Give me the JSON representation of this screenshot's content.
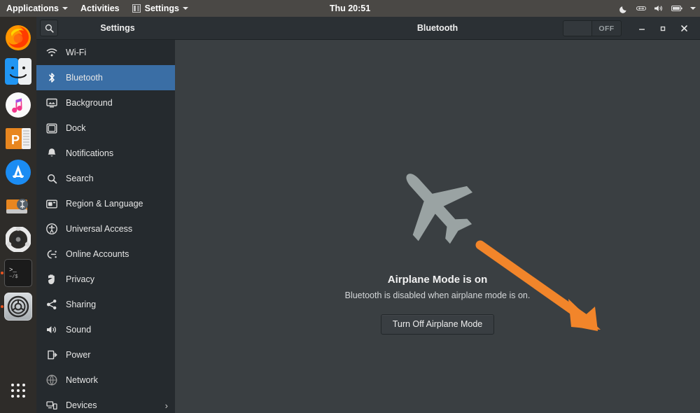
{
  "topbar": {
    "applications": {
      "label": "Applications",
      "icon": "chevron-down-icon"
    },
    "activities": {
      "label": "Activities"
    },
    "settings": {
      "label": "Settings",
      "icon": "settings-app-icon"
    },
    "clock": "Thu 20:51",
    "status_icons": [
      "night-light-moon-icon",
      "network-wired-icon",
      "volume-icon",
      "battery-icon",
      "chevron-down-icon"
    ]
  },
  "dock": {
    "items": [
      {
        "name": "firefox",
        "label": "Firefox"
      },
      {
        "name": "finder",
        "label": "Finder"
      },
      {
        "name": "music",
        "label": "Music"
      },
      {
        "name": "powerpoint",
        "label": "PowerPoint"
      },
      {
        "name": "app-store",
        "label": "App Store"
      },
      {
        "name": "disk-utility",
        "label": "Disk Utility"
      },
      {
        "name": "ubuntu-software",
        "label": "Ubuntu Software"
      },
      {
        "name": "terminal",
        "label": "Terminal"
      },
      {
        "name": "settings",
        "label": "Settings"
      }
    ],
    "show_apps_label": "Show Applications"
  },
  "window": {
    "sidebar_title": "Settings",
    "title": "Bluetooth",
    "search_placeholder": "Search settings",
    "toggle": {
      "state_label": "OFF",
      "checked": false
    },
    "controls": {
      "minimize": "‒",
      "maximize": "□",
      "close": "✕"
    }
  },
  "sidebar": {
    "items": [
      {
        "label": "Wi-Fi",
        "icon": "wifi-icon",
        "selected": false,
        "chevron": false
      },
      {
        "label": "Bluetooth",
        "icon": "bluetooth-icon",
        "selected": true,
        "chevron": false
      },
      {
        "label": "Background",
        "icon": "background-icon",
        "selected": false,
        "chevron": false
      },
      {
        "label": "Dock",
        "icon": "dock-icon",
        "selected": false,
        "chevron": false
      },
      {
        "label": "Notifications",
        "icon": "bell-icon",
        "selected": false,
        "chevron": false
      },
      {
        "label": "Search",
        "icon": "search-icon",
        "selected": false,
        "chevron": false
      },
      {
        "label": "Region & Language",
        "icon": "region-language-icon",
        "selected": false,
        "chevron": false
      },
      {
        "label": "Universal Access",
        "icon": "universal-access-icon",
        "selected": false,
        "chevron": false
      },
      {
        "label": "Online Accounts",
        "icon": "online-accounts-icon",
        "selected": false,
        "chevron": false
      },
      {
        "label": "Privacy",
        "icon": "privacy-hand-icon",
        "selected": false,
        "chevron": false
      },
      {
        "label": "Sharing",
        "icon": "sharing-icon",
        "selected": false,
        "chevron": false
      },
      {
        "label": "Sound",
        "icon": "sound-icon",
        "selected": false,
        "chevron": false
      },
      {
        "label": "Power",
        "icon": "power-icon",
        "selected": false,
        "chevron": false
      },
      {
        "label": "Network",
        "icon": "network-icon",
        "selected": false,
        "chevron": false
      },
      {
        "label": "Devices",
        "icon": "devices-icon",
        "selected": false,
        "chevron": true
      }
    ]
  },
  "main": {
    "illustration": "airplane-icon",
    "title": "Airplane Mode is on",
    "subtitle": "Bluetooth is disabled when airplane mode is on.",
    "button_label": "Turn Off Airplane Mode",
    "annotation": {
      "type": "arrow",
      "color": "#f2852a",
      "points_to": "Turn Off Airplane Mode"
    }
  },
  "colors": {
    "accent_blue": "#3a6ea5",
    "annotation_orange": "#f2852a",
    "topbar": "#4a4845",
    "dock": "#2e2c29",
    "sidebar": "#252a2e",
    "content": "#3a3f42",
    "titlebar": "#2b3034"
  }
}
